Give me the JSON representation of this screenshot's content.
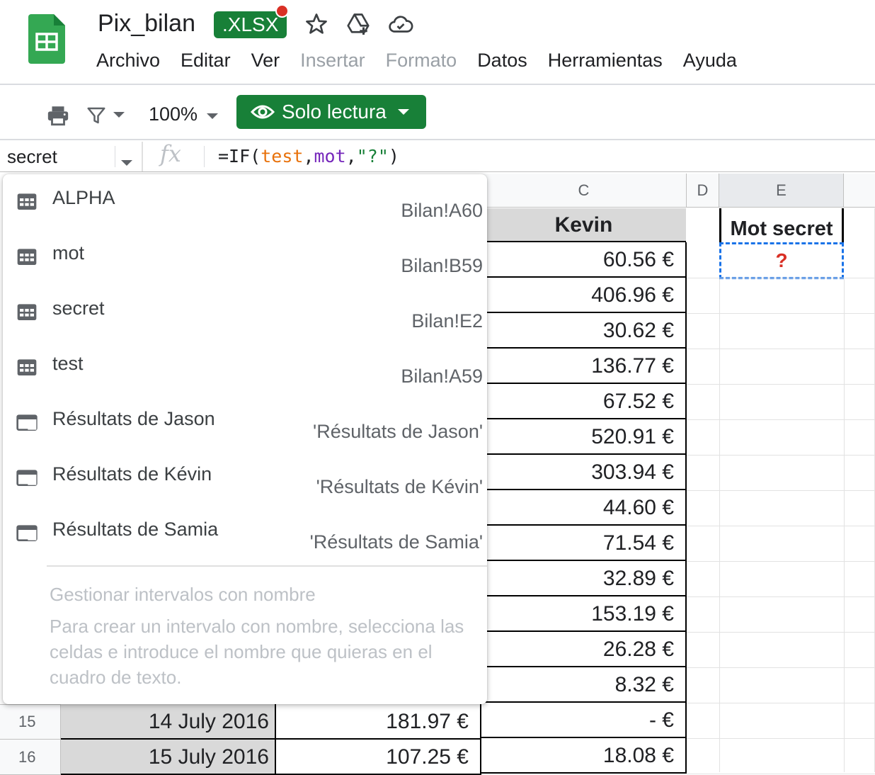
{
  "header": {
    "doc_title": "Pix_bilan",
    "format_badge": ".XLSX",
    "icons": [
      "star-icon",
      "move-to-drive-icon",
      "cloud-saved-icon"
    ]
  },
  "menu": [
    {
      "label": "Archivo",
      "enabled": true
    },
    {
      "label": "Editar",
      "enabled": true
    },
    {
      "label": "Ver",
      "enabled": true
    },
    {
      "label": "Insertar",
      "enabled": false
    },
    {
      "label": "Formato",
      "enabled": false
    },
    {
      "label": "Datos",
      "enabled": true
    },
    {
      "label": "Herramientas",
      "enabled": true
    },
    {
      "label": "Ayuda",
      "enabled": true
    }
  ],
  "toolbar": {
    "zoom": "100%",
    "readonly_label": "Solo lectura"
  },
  "formula_bar": {
    "name_box": "secret",
    "fx": "fx",
    "formula_parts": [
      {
        "text": "=IF(",
        "kind": "fn"
      },
      {
        "text": "test",
        "kind": "a"
      },
      {
        "text": ",",
        "kind": "fn"
      },
      {
        "text": "mot",
        "kind": "b"
      },
      {
        "text": ",",
        "kind": "fn"
      },
      {
        "text": "\"?\"",
        "kind": "s"
      },
      {
        "text": ")",
        "kind": "fn"
      }
    ]
  },
  "columns": [
    "C",
    "D",
    "E"
  ],
  "headers": {
    "kevin": "Kevin",
    "mot_secret": "Mot secret"
  },
  "selected_cell_value": "?",
  "kevin_values": [
    "60.56 €",
    "406.96 €",
    "30.62 €",
    "136.77 €",
    "67.52 €",
    "520.91 €",
    "303.94 €",
    "44.60 €",
    "71.54 €",
    "32.89 €",
    "153.19 €",
    "26.28 €",
    "8.32 €",
    "-    €",
    "18.08 €"
  ],
  "visible_rows": [
    {
      "num": "15",
      "date": "14 July 2016",
      "amount": "181.97 €"
    },
    {
      "num": "16",
      "date": "15 July 2016",
      "amount": "107.25 €"
    }
  ],
  "named_ranges": [
    {
      "name": "ALPHA",
      "ref": "Bilan!A60",
      "type": "range"
    },
    {
      "name": "mot",
      "ref": "Bilan!B59",
      "type": "range"
    },
    {
      "name": "secret",
      "ref": "Bilan!E2",
      "type": "range"
    },
    {
      "name": "test",
      "ref": "Bilan!A59",
      "type": "range"
    },
    {
      "name": "Résultats de Jason",
      "ref": "'Résultats de Jason'",
      "type": "sheet"
    },
    {
      "name": "Résultats de Kévin",
      "ref": "'Résultats de Kévin'",
      "type": "sheet"
    },
    {
      "name": "Résultats de Samia",
      "ref": "'Résultats de Samia'",
      "type": "sheet"
    }
  ],
  "manage_label": "Gestionar intervalos con nombre",
  "manage_help": "Para crear un intervalo con nombre, selecciona las celdas e introduce el nombre que quieras en el cuadro de texto."
}
